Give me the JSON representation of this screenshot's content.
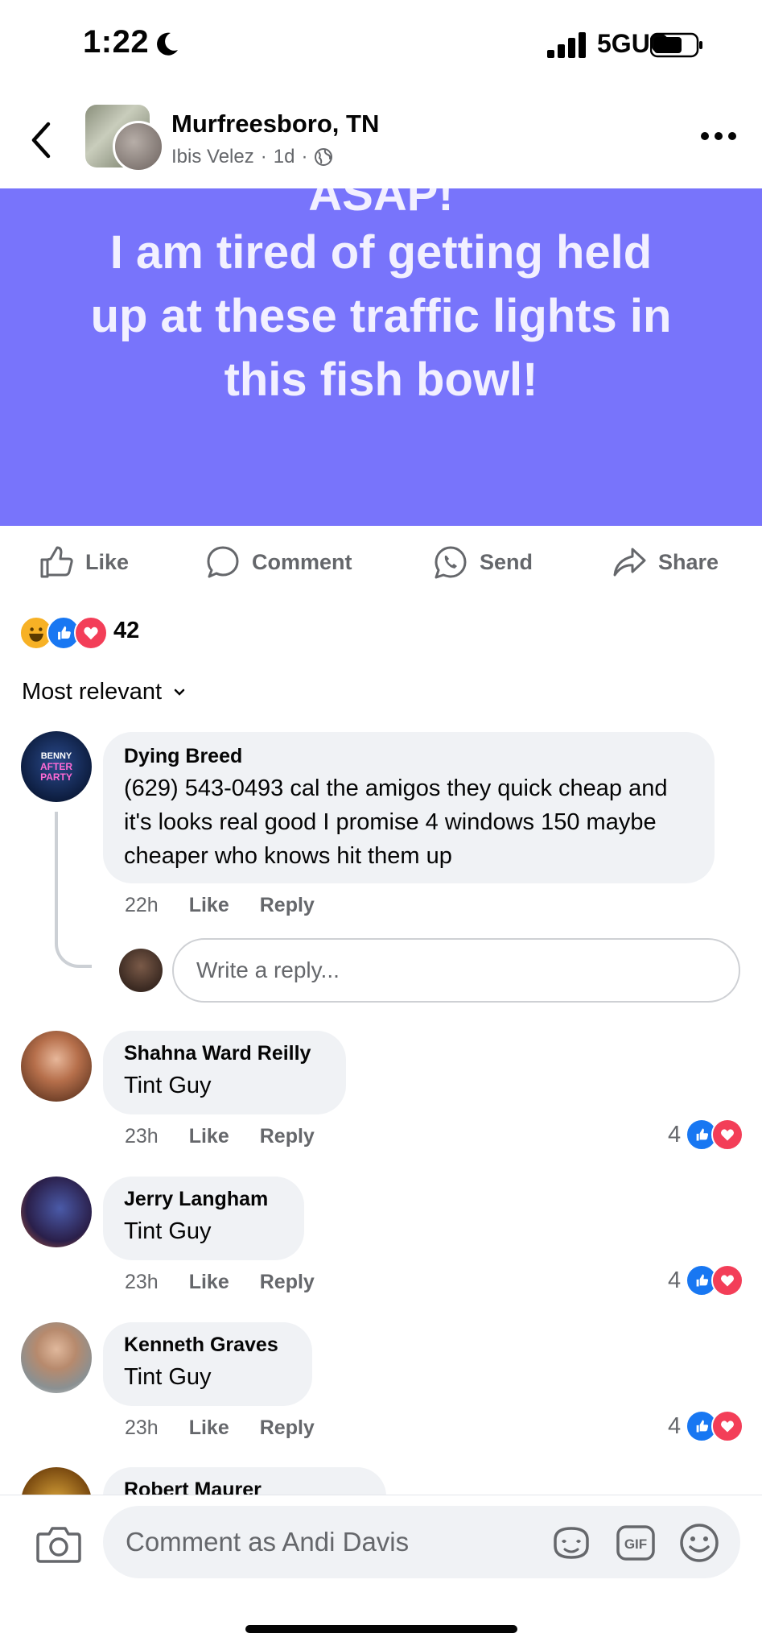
{
  "status_bar": {
    "time": "1:22",
    "network": "5GUC"
  },
  "header": {
    "group_name": "Murfreesboro, TN",
    "author": "Ibis Velez",
    "age": "1d"
  },
  "post": {
    "banner_lines": [
      "ASAP!",
      "I am tired of getting held",
      "up at these traffic lights in",
      "this fish bowl!"
    ],
    "background_color": "#7874fb"
  },
  "actions": {
    "like": "Like",
    "comment": "Comment",
    "send": "Send",
    "share": "Share"
  },
  "reactions": {
    "count": "42",
    "types": [
      "haha",
      "like",
      "love"
    ]
  },
  "sort_label": "Most relevant",
  "comments": [
    {
      "name": "Dying Breed",
      "text": "(629) 543-0493 cal the amigos they quick cheap and it's looks real good I promise 4 windows 150 maybe cheaper who knows hit them up",
      "time": "22h",
      "like": "Like",
      "reply": "Reply"
    },
    {
      "name": "Shahna Ward Reilly",
      "text": "Tint Guy",
      "time": "23h",
      "like": "Like",
      "reply": "Reply",
      "reaction_count": "4"
    },
    {
      "name": "Jerry Langham",
      "text": "Tint Guy",
      "time": "23h",
      "like": "Like",
      "reply": "Reply",
      "reaction_count": "4"
    },
    {
      "name": "Kenneth Graves",
      "text": "Tint Guy",
      "time": "23h",
      "like": "Like",
      "reply": "Reply",
      "reaction_count": "4"
    },
    {
      "name": "Robert Maurer"
    }
  ],
  "reply_placeholder": "Write a reply...",
  "composer_placeholder": "Comment as Andi Davis",
  "colors": {
    "like_blue": "#1877f2",
    "love_red": "#f33e58",
    "haha_yellow": "#f7b125",
    "meta_gray": "#65676b"
  }
}
